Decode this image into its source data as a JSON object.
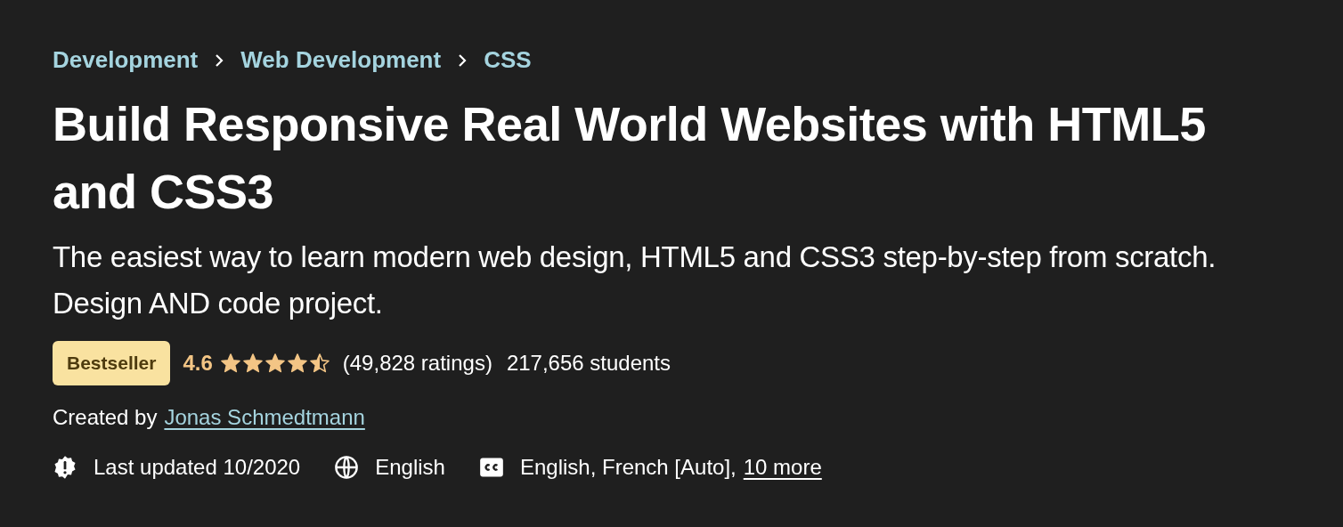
{
  "breadcrumbs": [
    "Development",
    "Web Development",
    "CSS"
  ],
  "title": "Build Responsive Real World Websites with HTML5 and CSS3",
  "subtitle": "The easiest way to learn modern web design, HTML5 and CSS3 step-by-step from scratch. Design AND code project.",
  "badge": "Bestseller",
  "rating": "4.6",
  "stars": 4.5,
  "ratings_count": "(49,828 ratings)",
  "students": "217,656 students",
  "created_by": {
    "label": "Created by",
    "author": "Jonas Schmedtmann"
  },
  "meta": [
    {
      "kind": "updated",
      "text": "Last updated 10/2020"
    },
    {
      "kind": "language",
      "text": "English"
    },
    {
      "kind": "captions",
      "text": "English, French [Auto],",
      "link": "10 more"
    }
  ]
}
